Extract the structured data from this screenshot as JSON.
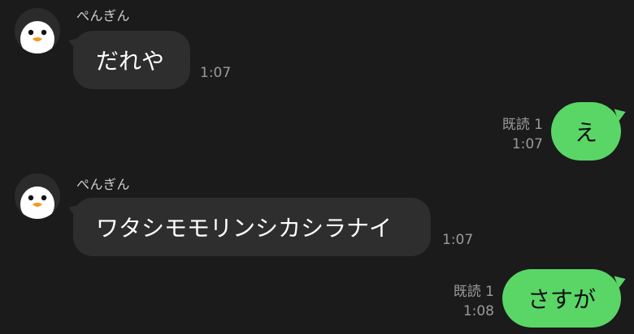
{
  "chat": {
    "messages": [
      {
        "direction": "incoming",
        "sender": "ぺんぎん",
        "text": "だれや",
        "time": "1:07"
      },
      {
        "direction": "outgoing",
        "read": "既読 1",
        "text": "え",
        "time": "1:07"
      },
      {
        "direction": "incoming",
        "sender": "ぺんぎん",
        "text": "ワタシモモリンシカシラナイ",
        "time": "1:07"
      },
      {
        "direction": "outgoing",
        "read": "既読 1",
        "text": "さすが",
        "time": "1:08"
      }
    ]
  },
  "colors": {
    "background": "#1b1b1b",
    "incoming_bubble": "#2e2e2e",
    "outgoing_bubble": "#5ad667",
    "meta_text": "#9a9a9a"
  },
  "icons": {
    "avatar": "penguin-icon"
  }
}
